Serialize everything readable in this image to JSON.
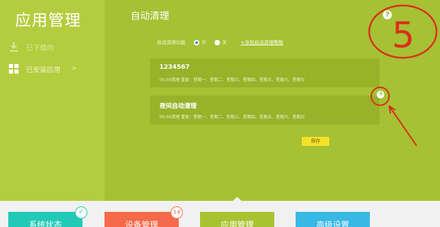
{
  "app": {
    "title": "应用管理"
  },
  "sidebar": {
    "items": [
      {
        "label": "已下载的",
        "icon": "download-icon"
      },
      {
        "label": "已安装应用",
        "icon": "grid-icon",
        "chevron": ">"
      }
    ]
  },
  "main": {
    "title": "自动清理",
    "help_label": "?",
    "toggle": {
      "label": "自动清理功能",
      "option_on": "开",
      "option_off": "关",
      "selected": "开",
      "link": "+添加自动清理策略"
    },
    "schedules": [
      {
        "name": "1234567",
        "days": "00:00清理  重复：星期一、星期二、星期三、星期四、星期五、星期六、星期日",
        "remove_label": "×"
      },
      {
        "name": "夜间自动清理",
        "days": "00:00清理  重复：星期一、星期二、星期三、星期四、星期五、星期六、星期日",
        "remove_label": "×"
      }
    ],
    "save_label": "保存"
  },
  "annotation": {
    "number": "5",
    "color": "#d9301a"
  },
  "bottom_tabs": [
    {
      "label": "系统状态",
      "color": "#22c9b7",
      "badge": "✓"
    },
    {
      "label": "设备管理",
      "color": "#f56a4a",
      "badge": "14"
    },
    {
      "label": "应用管理",
      "color": "#a9c330"
    },
    {
      "label": "高级设置",
      "color": "#38b8e4"
    }
  ]
}
